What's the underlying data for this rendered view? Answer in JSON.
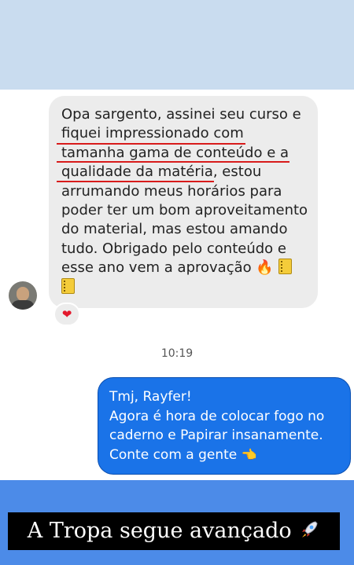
{
  "incoming_message": {
    "lines": [
      "Opa sargento, assinei seu curso e",
      "fiquei impressionado com",
      "tamanha gama de conteúdo e a",
      "qualidade da matéria",
      ", estou",
      "arrumando meus horários para",
      "poder ter um bom aproveitamento",
      "do material, mas estou amando",
      "tudo. Obrigado pelo conteúdo e",
      "esse ano vem a aprovação"
    ],
    "emojis": [
      "fire-emoji",
      "notebook-emoji",
      "notebook-emoji"
    ],
    "reaction": "❤",
    "highlight_color": "#d81b1b"
  },
  "timestamp": "10:19",
  "outgoing_message": {
    "lines": [
      "Tmj, Rayfer!",
      "Agora é hora de colocar fogo no",
      "caderno e Papirar insanamente.",
      "Conte com a gente"
    ],
    "emoji": "backhand-pointing-emoji",
    "bubble_color": "#1a73e8"
  },
  "banner": {
    "text": "A Tropa segue avançado",
    "icon": "rocket-icon"
  },
  "colors": {
    "top_band": "#c9dcef",
    "bottom_band": "#4c8be8",
    "incoming_bubble": "#ececec"
  }
}
